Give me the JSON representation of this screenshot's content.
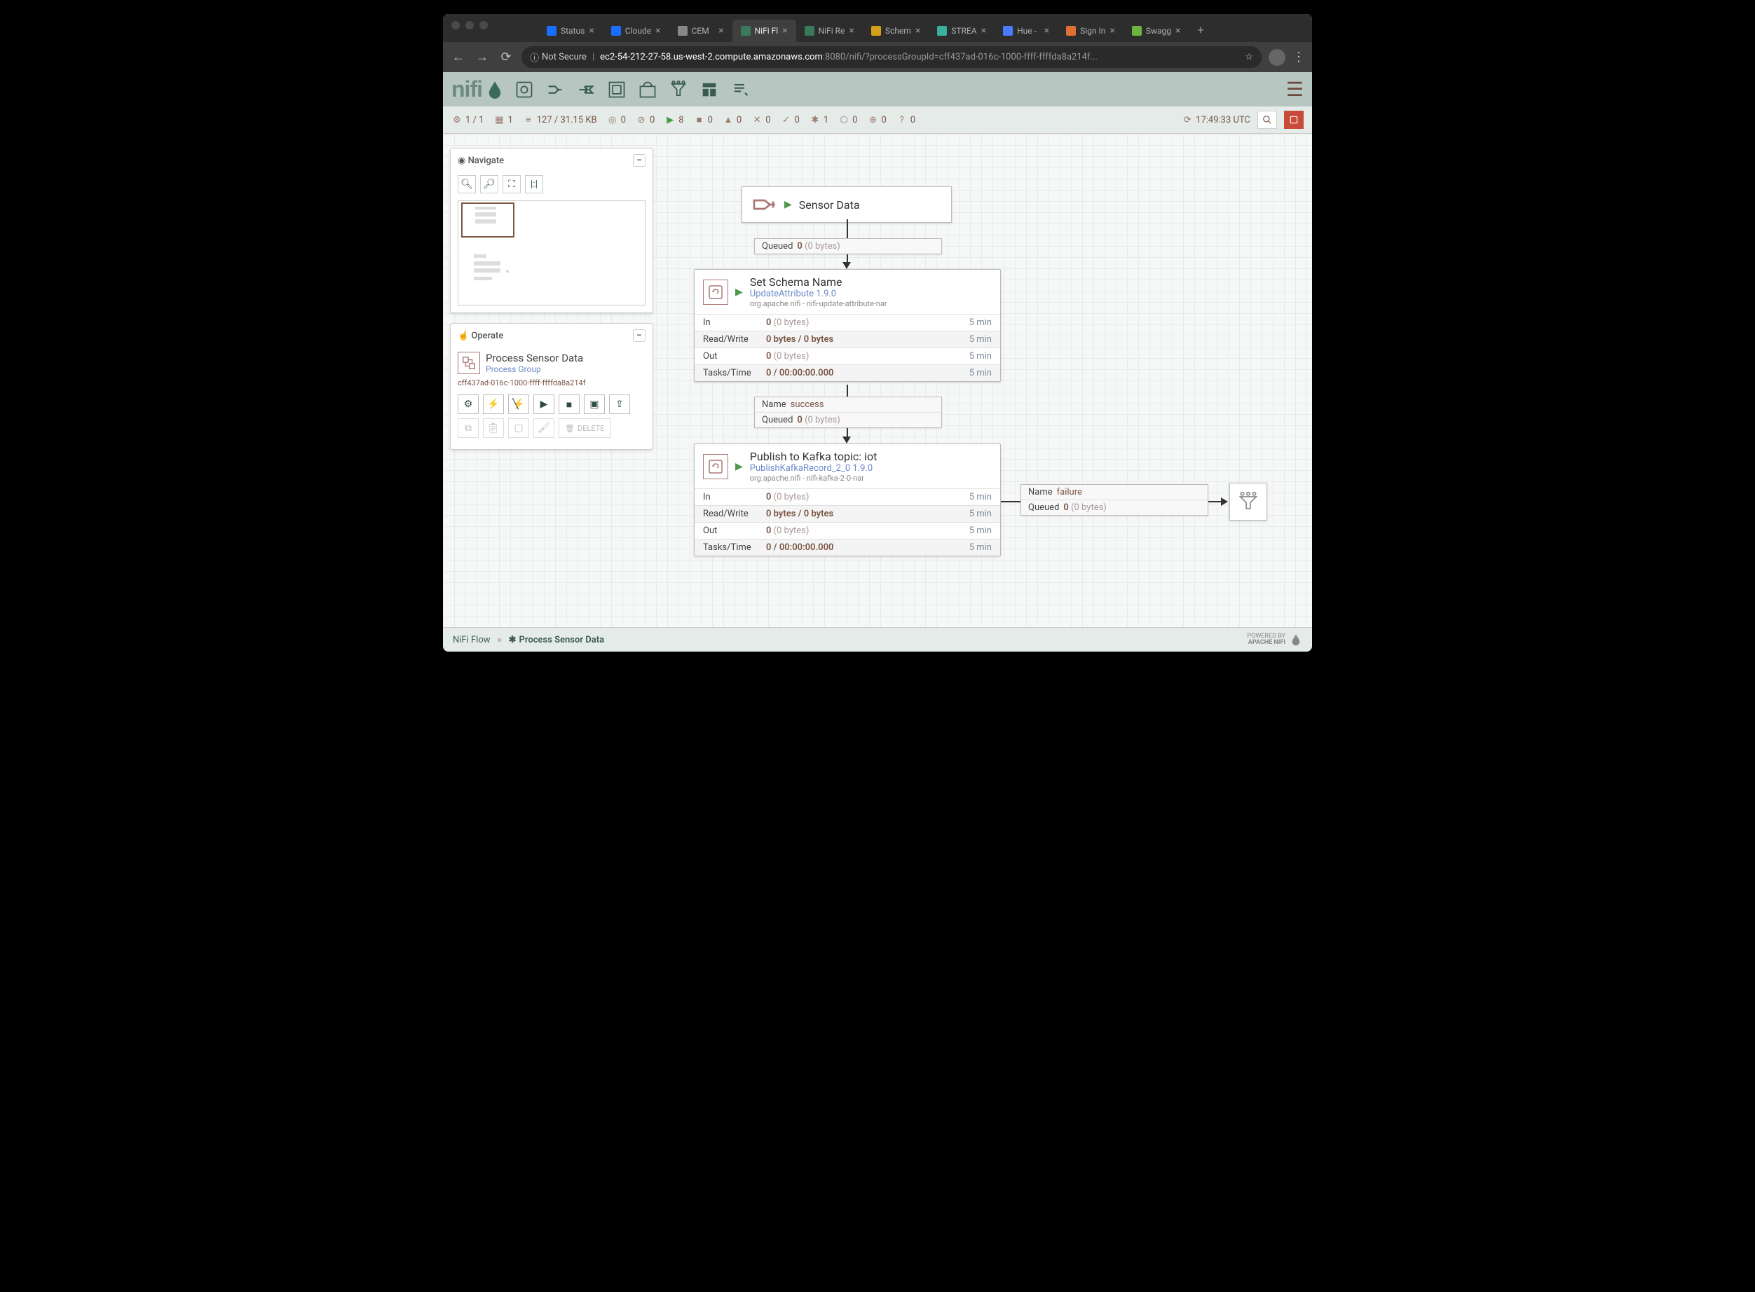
{
  "browser": {
    "tabs": [
      {
        "title": "Status",
        "favicon": "#1a6eff"
      },
      {
        "title": "Cloude",
        "favicon": "#1a6eff"
      },
      {
        "title": "CEM",
        "favicon": "#888"
      },
      {
        "title": "NiFi Fl",
        "favicon": "#3a7a5a",
        "active": true
      },
      {
        "title": "NiFi Re",
        "favicon": "#3a7a5a"
      },
      {
        "title": "Schem",
        "favicon": "#d4a017"
      },
      {
        "title": "STREA",
        "favicon": "#3ab0a0"
      },
      {
        "title": "Hue - ",
        "favicon": "#4a7aff"
      },
      {
        "title": "Sign In",
        "favicon": "#e07030"
      },
      {
        "title": "Swagg",
        "favicon": "#6db33f"
      }
    ],
    "security": "Not Secure",
    "url_host": "ec2-54-212-27-58.us-west-2.compute.amazonaws.com",
    "url_port_path": ":8080/nifi/?processGroupId=cff437ad-016c-1000-ffff-ffffda8a214f..."
  },
  "status": {
    "nodes": "1 / 1",
    "threads": "1",
    "queued": "127 / 31.15 KB",
    "transmitting": "0",
    "not_transmitting": "0",
    "running": "8",
    "stopped": "0",
    "invalid": "0",
    "disabled": "0",
    "up_to_date": "0",
    "stale": "1",
    "locally_modified": "0",
    "sync_failure": "0",
    "unknown": "0",
    "refreshed": "17:49:33 UTC"
  },
  "navigate": {
    "title": "Navigate"
  },
  "operate": {
    "title": "Operate",
    "name": "Process Sensor Data",
    "type": "Process Group",
    "id": "cff437ad-016c-1000-ffff-ffffda8a214f",
    "delete": "DELETE"
  },
  "canvas": {
    "input_port": {
      "name": "Sensor Data"
    },
    "conn1": {
      "queued_label": "Queued",
      "queued_val": "0",
      "queued_size": "(0 bytes)"
    },
    "proc1": {
      "name": "Set Schema Name",
      "type": "UpdateAttribute 1.9.0",
      "bundle": "org.apache.nifi - nifi-update-attribute-nar",
      "in_label": "In",
      "in_val": "0",
      "in_size": "(0 bytes)",
      "in_time": "5 min",
      "rw_label": "Read/Write",
      "rw_val": "0 bytes / 0 bytes",
      "rw_time": "5 min",
      "out_label": "Out",
      "out_val": "0",
      "out_size": "(0 bytes)",
      "out_time": "5 min",
      "tt_label": "Tasks/Time",
      "tt_val": "0 / 00:00:00.000",
      "tt_time": "5 min"
    },
    "conn2": {
      "name_label": "Name",
      "name_val": "success",
      "queued_label": "Queued",
      "queued_val": "0",
      "queued_size": "(0 bytes)"
    },
    "proc2": {
      "name": "Publish to Kafka topic: iot",
      "type": "PublishKafkaRecord_2_0 1.9.0",
      "bundle": "org.apache.nifi - nifi-kafka-2-0-nar",
      "in_label": "In",
      "in_val": "0",
      "in_size": "(0 bytes)",
      "in_time": "5 min",
      "rw_label": "Read/Write",
      "rw_val": "0 bytes / 0 bytes",
      "rw_time": "5 min",
      "out_label": "Out",
      "out_val": "0",
      "out_size": "(0 bytes)",
      "out_time": "5 min",
      "tt_label": "Tasks/Time",
      "tt_val": "0 / 00:00:00.000",
      "tt_time": "5 min"
    },
    "conn3": {
      "name_label": "Name",
      "name_val": "failure",
      "queued_label": "Queued",
      "queued_val": "0",
      "queued_size": "(0 bytes)"
    }
  },
  "breadcrumb": {
    "root": "NiFi Flow",
    "sep": "»",
    "current": "Process Sensor Data"
  },
  "powered": {
    "line1": "POWERED BY",
    "line2": "APACHE NIFI"
  }
}
